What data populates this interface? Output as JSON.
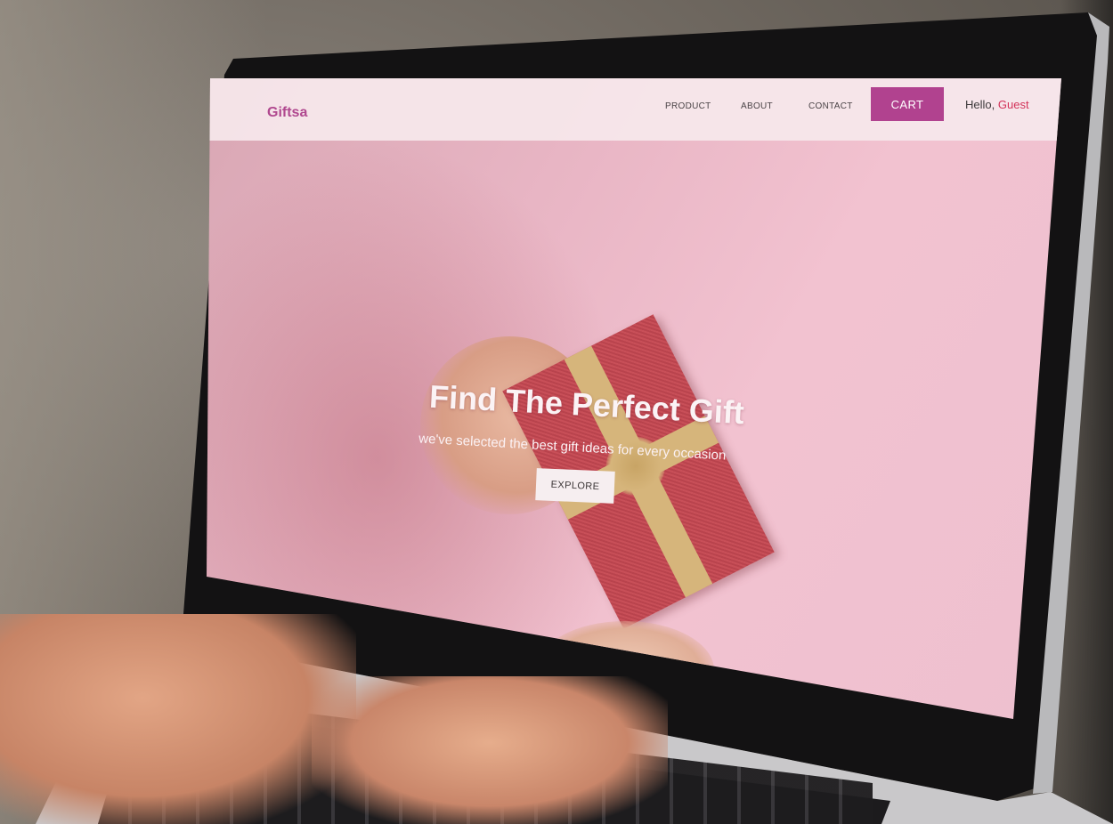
{
  "navbar": {
    "logo": "Giftsa",
    "links": [
      "PRODUCT",
      "ABOUT",
      "CONTACT"
    ],
    "cart_label": "CART",
    "hello_prefix": "Hello,",
    "hello_user": "Guest"
  },
  "hero": {
    "title": "Find The Perfect Gift",
    "subtitle": "we've selected the best gift ideas for every occasion",
    "explore_label": "EXPLORE"
  },
  "colors": {
    "brand": "#b0488f",
    "cart": "#b1428f",
    "guest": "#d3335a"
  }
}
